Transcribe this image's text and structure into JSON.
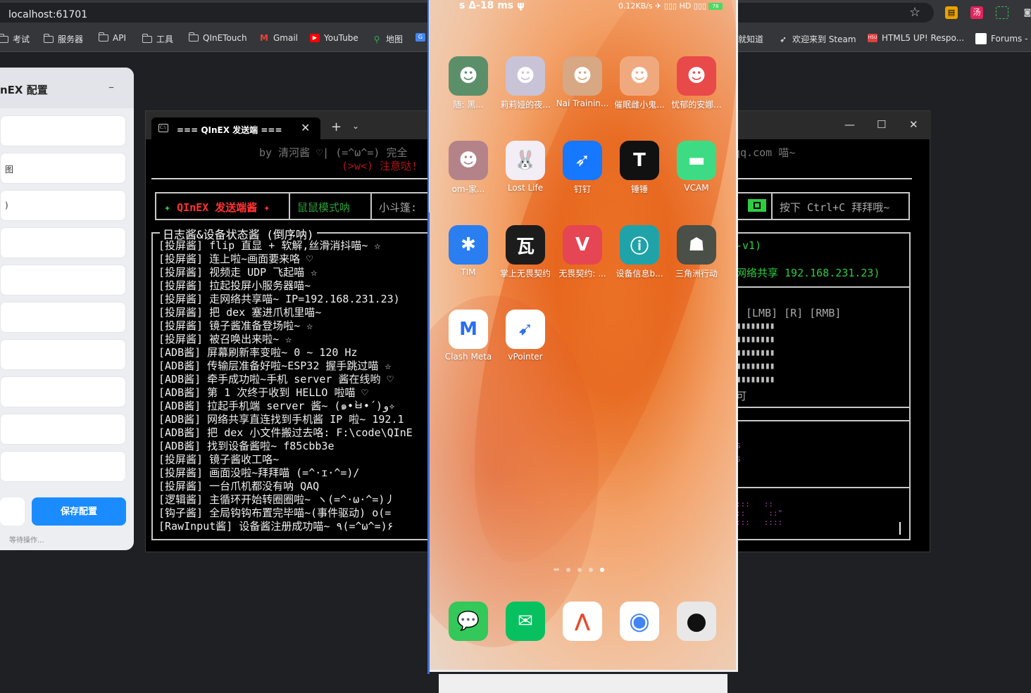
{
  "browser": {
    "url": "localhost:61701",
    "bookmarks": [
      {
        "label": "考试",
        "type": "folder"
      },
      {
        "label": "服务器",
        "type": "folder"
      },
      {
        "label": "API",
        "type": "folder"
      },
      {
        "label": "工具",
        "type": "folder"
      },
      {
        "label": "QInETouch",
        "type": "folder"
      },
      {
        "label": "Gmail",
        "type": "gmail"
      },
      {
        "label": "YouTube",
        "type": "youtube"
      },
      {
        "label": "地图",
        "type": "maps"
      },
      {
        "label": "就知道",
        "type": "site"
      },
      {
        "label": "欢迎来到 Steam",
        "type": "steam"
      },
      {
        "label": "HTML5 UP! Respo...",
        "type": "html5up"
      },
      {
        "label": "Forums -",
        "type": "forums"
      }
    ]
  },
  "config_panel": {
    "title": "nEX 配置",
    "minimize": "–",
    "fields": [
      "",
      "图",
      ")",
      "",
      "",
      "",
      "",
      "",
      "",
      ""
    ],
    "save_label": "保存配置",
    "status": "等待操作..."
  },
  "terminal": {
    "tab_title": "=== QInEX 发送端 ===",
    "new_tab": "+",
    "by_line": "by 清河酱 ♡| (=^ω^=) 完全",
    "by_right": "qq.com 喵~",
    "warn_line": "(>w<) 注意哒!",
    "status_title_star": "✦",
    "status_title": "QInEX 发送端酱",
    "status_title_star2": "✦",
    "mode": "鼠鼠模式呐",
    "cloak": "小斗篷:",
    "exit_hint": "按下 Ctrl+C 拜拜哦~",
    "log_title": "日志酱&设备状态酱 (倒序呐)",
    "log_lines": [
      "[投屏酱] flip 直显 + 软解,丝滑消抖喵~ ☆",
      "[投屏酱] 连上啦~画面要来咯 ♡",
      "[投屏酱] 视频走 UDP 飞起喵 ☆",
      "[投屏酱] 拉起投屏小服务器喵~",
      "[投屏酱] 走网络共享喵~ IP=192.168.231.23)",
      "[投屏酱] 把 dex 塞进爪机里喵~",
      "[投屏酱] 镜子酱准备登场啦~ ☆",
      "[投屏酱] 被召唤出来啦~ ☆",
      "[ADB酱] 屏幕刷新率变啦~ 0 ~ 120 Hz",
      "[ADB酱] 传输层准备好啦~ESP32 握手跳过喵 ☆",
      "[ADB酱] 牵手成功啦~手机 server 酱在线哟 ♡",
      "[ADB酱] 第 1 次终于收到 HELLO 啦喵 ♡",
      "[ADB酱] 拉起手机端 server 酱~ (๑•̀ㅂ•́)و✧",
      "[ADB酱] 网络共享直连找到手机酱 IP 啦~ 192.1",
      "[ADB酱] 把 dex 小文件搬过去咯: F:\\code\\QInE",
      "[ADB酱] 找到设备酱啦~ f85cbb3e",
      "[投屏酱] 镜子酱收工咯~",
      "[投屏酱] 画面没啦~拜拜喵 (=^·ɪ·^=)/",
      "[投屏酱] 一台爪机都没有呐 QAQ",
      "[逻辑酱] 主循环开始转圈圈啦~ ヽ(=^·ω·^=)丿",
      "[钩子酱] 全局钩钩布置完毕喵~(事件驱动) o(=",
      "[RawInput酱] 设备酱注册成功喵~ ٩(=^ω^=)۶"
    ],
    "right": {
      "version": "-v1)",
      "network": "网络共享 192.168.231.23)",
      "buttons": "[LMB]  [R]  [RMB]",
      "hint": "可",
      "mini1": "s",
      "mini2": "s",
      "dots": ":::   ::\n::     ::\"\n:::   ::::"
    }
  },
  "phone": {
    "status_left": "s  Δ-18 ms ψ",
    "status_right": "0.12KB/s ✈ ▯▯▯ HD ▯▯▯ ⚡",
    "battery": "78",
    "toolbar": [
      "⚙",
      "☝",
      "⤢",
      "⊸",
      "↻",
      "□",
      "✕"
    ],
    "apps": [
      {
        "label": "随: 黑...",
        "bg": "#5b8f6a",
        "glyph": "☻"
      },
      {
        "label": "莉莉娅的夜...",
        "bg": "#c9c3d8",
        "glyph": "☻"
      },
      {
        "label": "Nai Trainin...",
        "bg": "#d8a783",
        "glyph": "☻"
      },
      {
        "label": "催眠雌小鬼...",
        "bg": "#f0a97f",
        "glyph": "☻"
      },
      {
        "label": "忧郁的安娜...",
        "bg": "#e84a4a",
        "glyph": "☻"
      },
      {
        "label": "om-家...",
        "bg": "#b4838a",
        "glyph": "☻"
      },
      {
        "label": "Lost Life",
        "bg": "#f3eef6",
        "glyph": "🐰"
      },
      {
        "label": "钉钉",
        "bg": "#1677ff",
        "glyph": "➶"
      },
      {
        "label": "锤锤",
        "bg": "#111111",
        "glyph": "T"
      },
      {
        "label": "VCAM",
        "bg": "#3ddc84",
        "glyph": "▬"
      },
      {
        "label": "TIM",
        "bg": "#2a7ef0",
        "glyph": "✱"
      },
      {
        "label": "掌上无畏契约",
        "bg": "#1c1c1c",
        "glyph": "瓦"
      },
      {
        "label": "无畏契约: ...",
        "bg": "#e64553",
        "glyph": "V"
      },
      {
        "label": "设备信息b...",
        "bg": "#1fa3a8",
        "glyph": "ⓘ"
      },
      {
        "label": "三角洲行动",
        "bg": "#4a4f48",
        "glyph": "☗"
      },
      {
        "label": "Clash Meta",
        "bg": "#ffffff",
        "glyph": "M"
      },
      {
        "label": "vPointer",
        "bg": "#ffffff",
        "glyph": "➹"
      }
    ],
    "dock": [
      {
        "name": "messages",
        "bg": "#34c759",
        "glyph": "💬"
      },
      {
        "name": "wechat",
        "bg": "#07c160",
        "glyph": "✉"
      },
      {
        "name": "feishu",
        "bg": "#ffffff",
        "glyph": "⋀"
      },
      {
        "name": "chrome",
        "bg": "#ffffff",
        "glyph": "◉"
      },
      {
        "name": "camera",
        "bg": "#e8e8e8",
        "glyph": "●"
      }
    ]
  }
}
